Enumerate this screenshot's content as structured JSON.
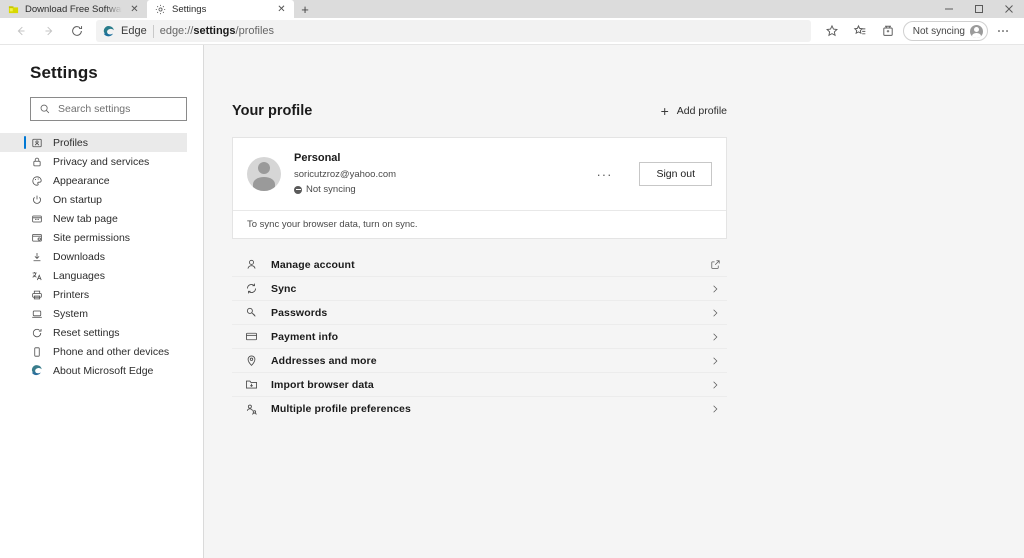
{
  "window": {
    "controls": [
      {
        "name": "minimize",
        "glyph": "—"
      },
      {
        "name": "maximize",
        "glyph": "□"
      },
      {
        "name": "close",
        "glyph": "✕"
      }
    ]
  },
  "tabs": [
    {
      "title": "Download Free Software for Wi",
      "icon": "folder-icon",
      "active": false,
      "close_glyph": "✕"
    },
    {
      "title": "Settings",
      "icon": "gear-icon",
      "active": true,
      "close_glyph": "✕"
    }
  ],
  "newtab_label": "+",
  "toolbar": {
    "back_icon": "back-arrow-icon",
    "forward_icon": "forward-arrow-icon",
    "refresh_icon": "refresh-icon",
    "edge_label": "Edge",
    "url_scheme": "edge://",
    "url_bold": "settings",
    "url_rest": "/profiles",
    "favorite_icon": "star-icon",
    "favorites_icon": "favorites-star-list-icon",
    "collections_icon": "collections-icon",
    "profile_pill_label": "Not syncing",
    "more_icon": "ellipsis-icon"
  },
  "sidebar": {
    "title": "Settings",
    "search": {
      "placeholder": "Search settings",
      "icon": "search-icon"
    },
    "items": [
      {
        "label": "Profiles",
        "icon": "profile-card-icon",
        "selected": true
      },
      {
        "label": "Privacy and services",
        "icon": "lock-icon",
        "selected": false
      },
      {
        "label": "Appearance",
        "icon": "palette-icon",
        "selected": false
      },
      {
        "label": "On startup",
        "icon": "power-icon",
        "selected": false
      },
      {
        "label": "New tab page",
        "icon": "new-tab-page-icon",
        "selected": false
      },
      {
        "label": "Site permissions",
        "icon": "site-permissions-icon",
        "selected": false
      },
      {
        "label": "Downloads",
        "icon": "download-icon",
        "selected": false
      },
      {
        "label": "Languages",
        "icon": "languages-icon",
        "selected": false
      },
      {
        "label": "Printers",
        "icon": "printer-icon",
        "selected": false
      },
      {
        "label": "System",
        "icon": "system-icon",
        "selected": false
      },
      {
        "label": "Reset settings",
        "icon": "reset-icon",
        "selected": false
      },
      {
        "label": "Phone and other devices",
        "icon": "phone-icon",
        "selected": false
      },
      {
        "label": "About Microsoft Edge",
        "icon": "edge-logo-icon",
        "selected": false
      }
    ]
  },
  "main": {
    "title": "Your profile",
    "add_profile": {
      "label": "Add profile",
      "icon": "plus-icon"
    },
    "profile_card": {
      "name": "Personal",
      "email": "soricutzroz@yahoo.com",
      "sync_status": "Not syncing",
      "more_label": "···",
      "signout_label": "Sign out",
      "footer": "To sync your browser data, turn on sync."
    },
    "rows": [
      {
        "label": "Manage account",
        "icon": "person-icon",
        "trailing": "external-link-icon"
      },
      {
        "label": "Sync",
        "icon": "sync-icon",
        "trailing": "chevron-right-icon"
      },
      {
        "label": "Passwords",
        "icon": "key-icon",
        "trailing": "chevron-right-icon"
      },
      {
        "label": "Payment info",
        "icon": "card-icon",
        "trailing": "chevron-right-icon"
      },
      {
        "label": "Addresses and more",
        "icon": "location-pin-icon",
        "trailing": "chevron-right-icon"
      },
      {
        "label": "Import browser data",
        "icon": "import-folder-icon",
        "trailing": "chevron-right-icon"
      },
      {
        "label": "Multiple profile preferences",
        "icon": "multiple-profiles-icon",
        "trailing": "chevron-right-icon"
      }
    ]
  },
  "colors": {
    "accent": "#0078d4",
    "tabstrip_bg": "#dcdcdc",
    "page_bg": "#f5f5f5",
    "sidebar_bg": "#ffffff",
    "card_bg": "#ffffff"
  }
}
